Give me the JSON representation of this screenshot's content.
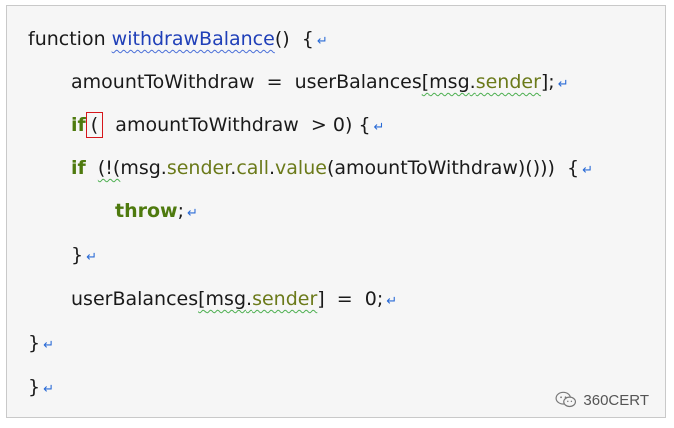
{
  "code": {
    "l1_kw": "function",
    "l1_name": "withdrawBalance",
    "l1_rest": "()",
    "l1_brace": "{",
    "l2_var": "amountToWithdraw",
    "l2_eq": "=",
    "l2_obj": "userBalances",
    "l2_open": "[",
    "l2_msg": "msg",
    "l2_dot": ".",
    "l2_sender": "sender",
    "l2_close": "];",
    "l3_if": "if",
    "l3_paren": "(",
    "l3_expr": "amountToWithdraw",
    "l3_gt": ">",
    "l3_zero": "0)",
    "l3_brace": "{",
    "l4_if": "if",
    "l4_open": "(!(",
    "l4_msg": "msg",
    "l4_dot1": ".",
    "l4_sender": "sender",
    "l4_dot2": ".",
    "l4_call": "call",
    "l4_dot3": ".",
    "l4_value": "value",
    "l4_arg": "(amountToWithdraw)()))",
    "l4_brace": "{",
    "l5_throw": "throw",
    "l5_semi": ";",
    "l6_close": "}",
    "l7_obj": "userBalances",
    "l7_open": "[",
    "l7_msg": "msg",
    "l7_dot": ".",
    "l7_sender": "sender",
    "l7_close": "]",
    "l7_eq": "=",
    "l7_val": "0;",
    "l8_close": "}",
    "l9_close": "}",
    "paragraph_mark": "↵"
  },
  "watermark": {
    "text": "360CERT",
    "icon": "wechat-icon"
  }
}
